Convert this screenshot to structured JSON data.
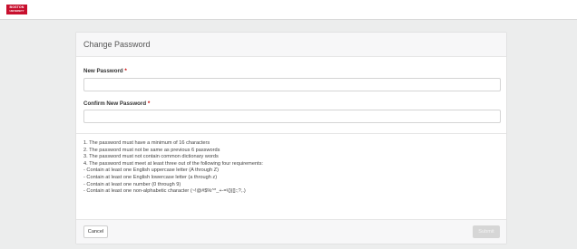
{
  "header": {
    "logo": {
      "line1": "BOSTON",
      "line2": "UNIVERSITY",
      "color": "#c8102e"
    }
  },
  "form": {
    "title": "Change Password",
    "new_password_label": "New Password",
    "confirm_password_label": "Confirm New Password",
    "required_marker": "*",
    "new_password_value": "",
    "confirm_password_value": "",
    "rules": [
      "1. The password must have a minimum of 16 characters",
      "2. The password must not be same as previous 6 passwords",
      "3. The password must not contain common dictionary words",
      "4. The password must meet at least three out of the following four requirements:",
      "- Contain at least one English uppercase letter (A through Z)",
      "- Contain at least one English lowercase letter (a through z)",
      "- Contain at least one number (0 through 9)",
      "- Contain at least one non-alphabetic character (~!@#$%^*_+-=\\{}|[]:;?,.)"
    ]
  },
  "footer": {
    "cancel_label": "Cancel",
    "submit_label": "Submit"
  }
}
